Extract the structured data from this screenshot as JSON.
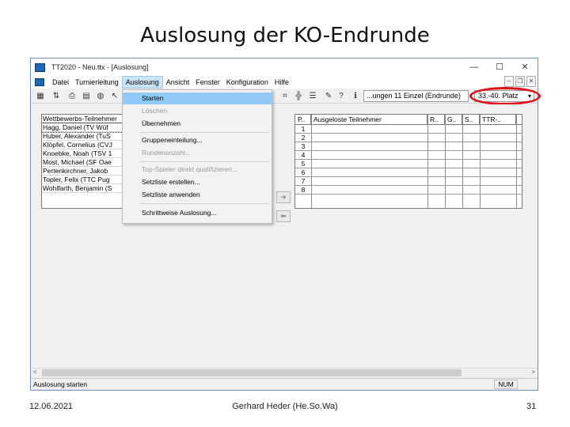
{
  "slide": {
    "title": "Auslosung der KO-Endrunde",
    "footer_date": "12.06.2021",
    "footer_author": "Gerhard Heder (He.So.Wa)",
    "page_number": "31"
  },
  "window": {
    "title": "TT2020 - Neu.ttx - [Auslosung]",
    "minimize": "—",
    "maximize": "☐",
    "close": "✕"
  },
  "menu": {
    "items": [
      "Datei",
      "Turnierleitung",
      "Auslosung",
      "Ansicht",
      "Fenster",
      "Konfiguration",
      "Hilfe"
    ],
    "mdi_min": "–",
    "mdi_restore": "❐",
    "mdi_close": "✕"
  },
  "toolbar": {
    "round_value": "...ungen 11 Einzel (Endrunde)",
    "place_value": "33.-40. Platz",
    "place_chevron": "▾"
  },
  "dropdown": {
    "items": [
      {
        "label": "Starten",
        "state": "highlighted"
      },
      {
        "label": "Löschen",
        "state": "disabled"
      },
      {
        "label": "Übernehmen",
        "state": "normal"
      },
      {
        "label": "Gruppeneinteilung...",
        "state": "normal"
      },
      {
        "label": "Rundenanzahl...",
        "state": "disabled"
      },
      {
        "label": "Top-Spieler direkt qualifizieren...",
        "state": "disabled"
      },
      {
        "label": "Setzliste erstellen...",
        "state": "normal"
      },
      {
        "label": "Setzliste anwenden",
        "state": "normal"
      },
      {
        "label": "Schrittweise Auslosung...",
        "state": "normal"
      }
    ]
  },
  "participants": {
    "header": "Wettbewerbs-Teilnehmer",
    "rows": [
      "Hagg, Daniel (TV Wüf",
      "Huber, Alexander (TuS",
      "Klöpfel, Cornelius (CVJ",
      "Knoebke, Noah (TSV 1",
      "Most, Michael (SF Oae",
      "Pertenkirchner, Jakob",
      "Topler, Felix (TTC Pug",
      "Wohlfarth, Benjamin (S"
    ]
  },
  "drawn_table": {
    "headers": [
      "P..",
      "Ausgeloste Teilnehmer",
      "R..",
      "G..",
      "S..",
      "TTR-.."
    ],
    "positions": [
      "1",
      "2",
      "3",
      "4",
      "5",
      "6",
      "7",
      "8"
    ]
  },
  "arrows": {
    "right": "➜",
    "left": "⬅"
  },
  "scroll": {
    "left": "<",
    "right": ">"
  },
  "status": {
    "text": "Auslosung starten",
    "num": "NUM"
  },
  "colors": {
    "highlight_ring": "#e0101a",
    "menu_highlight": "#91c9f7",
    "window_border": "#6a8fc9"
  }
}
